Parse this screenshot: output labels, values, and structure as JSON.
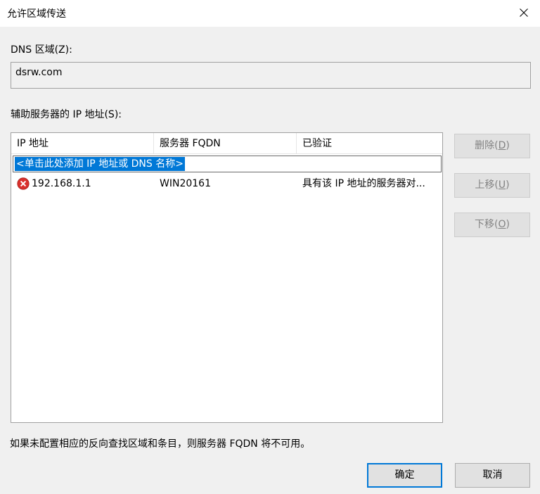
{
  "window": {
    "title": "允许区域传送",
    "close_glyph": "✕"
  },
  "dns_zone": {
    "label": "DNS 区域(Z):",
    "value": "dsrw.com"
  },
  "secondary_servers": {
    "label": "辅助服务器的 IP 地址(S):",
    "columns": [
      "IP 地址",
      "服务器 FQDN",
      "已验证"
    ],
    "add_placeholder": "<单击此处添加 IP 地址或 DNS 名称>",
    "rows": [
      {
        "status_icon": "error-icon",
        "ip": "192.168.1.1",
        "fqdn": "WIN20161",
        "verified": "具有该 IP 地址的服务器对..."
      }
    ]
  },
  "side_buttons": {
    "delete": {
      "text": "删除(",
      "key": "D",
      "close": ")"
    },
    "move_up": {
      "text": "上移(",
      "key": "U",
      "close": ")"
    },
    "move_down": {
      "text": "下移(",
      "key": "O",
      "close": ")"
    }
  },
  "footer": {
    "note": "如果未配置相应的反向查找区域和条目，则服务器 FQDN 将不可用。",
    "ok_label": "确定",
    "cancel_label": "取消"
  },
  "colors": {
    "selection": "#0078d7",
    "error": "#d9302c"
  }
}
